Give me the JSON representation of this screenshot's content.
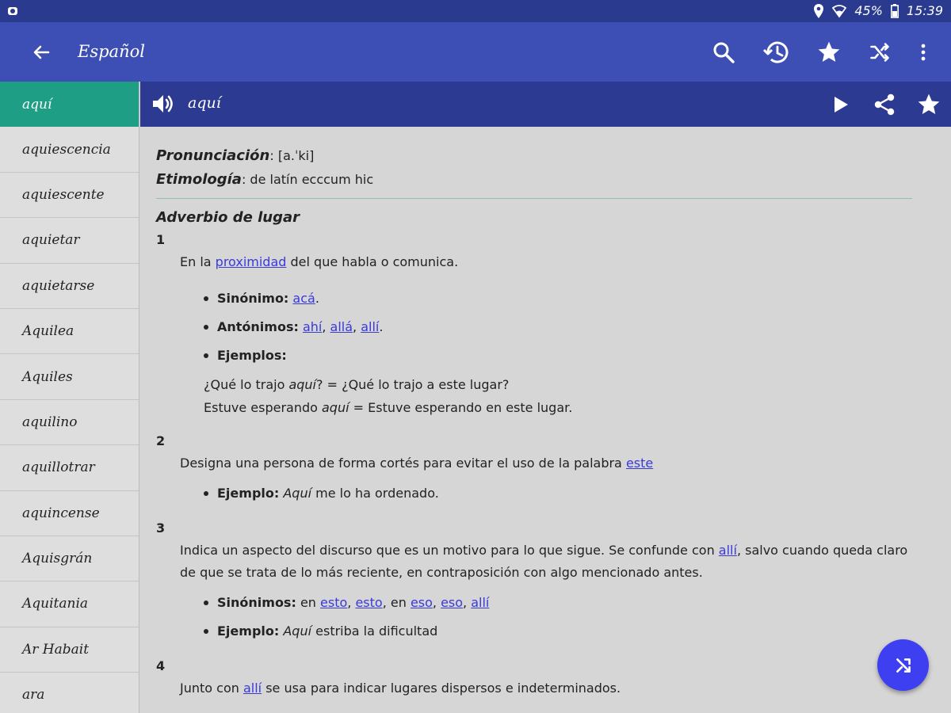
{
  "status_bar": {
    "battery": "45%",
    "time": "15:39"
  },
  "app_bar": {
    "title": "Español",
    "actions": [
      "search-icon",
      "history-icon",
      "star-icon",
      "shuffle-icon",
      "more-vert-icon"
    ]
  },
  "sidebar": {
    "items": [
      "aquí",
      "aquiescencia",
      "aquiescente",
      "aquietar",
      "aquietarse",
      "Aquilea",
      "Aquiles",
      "aquilino",
      "aquillotrar",
      "aquincense",
      "Aquisgrán",
      "Aquitania",
      "Ar Habait",
      "ara"
    ],
    "active_index": 0
  },
  "entry": {
    "word": "aquí",
    "pron_label": "Pronunciación",
    "pron_value": ": [a.ˈki]",
    "etym_label": "Etimología",
    "etym_value": ": de latín ecccum hic",
    "pos": "Adverbio de lugar",
    "senses": [
      {
        "num": "1",
        "def_pre": "En la ",
        "def_link": "proximidad",
        "def_post": " del que habla o comunica.",
        "syn_label": "Sinónimo:",
        "syn_link": "acá",
        "syn_tail": ".",
        "ant_label": "Antónimos:",
        "ant_links": [
          "ahí",
          "allá",
          "allí"
        ],
        "ant_tail": ".",
        "ex_label": "Ejemplos:",
        "ex1_pre": "¿Qué lo trajo ",
        "ex1_em": "aquí",
        "ex1_post": "? = ¿Qué lo trajo a este lugar?",
        "ex2_pre": "Estuve esperando ",
        "ex2_em": "aquí",
        "ex2_post": " = Estuve esperando en este lugar."
      },
      {
        "num": "2",
        "def_pre": "Designa una persona de forma cortés para evitar el uso de la palabra ",
        "def_link": "este",
        "ex_label": "Ejemplo:",
        "ex_em": "Aquí",
        "ex_post": " me lo ha ordenado."
      },
      {
        "num": "3",
        "def_pre": "Indica un aspecto del discurso que es un motivo para lo que sigue. Se confunde con ",
        "def_link": "allí",
        "def_post": ", salvo cuando queda claro de que se trata de lo más reciente, en contraposición con algo mencionado antes.",
        "syn_label": "Sinónimos:",
        "syn_pre1": " en ",
        "syn_link1": "esto",
        "syn_link2": "esto",
        "syn_pre2": ", en ",
        "syn_link3": "eso",
        "syn_link4": "eso",
        "syn_link5": "allí",
        "ex_label": "Ejemplo:",
        "ex_em": "Aquí",
        "ex_post": " estriba la dificultad"
      },
      {
        "num": "4",
        "def_pre": "Junto con ",
        "def_link": "allí",
        "def_post": " se usa para indicar lugares dispersos e indeterminados."
      }
    ]
  },
  "colors": {
    "status_bar": "#2a3a8e",
    "app_bar": "#3d4fb5",
    "word_bar": "#2c3a91",
    "active_item": "#1f9e86",
    "link": "#3a3ad8",
    "fab": "#3d3ff0"
  }
}
